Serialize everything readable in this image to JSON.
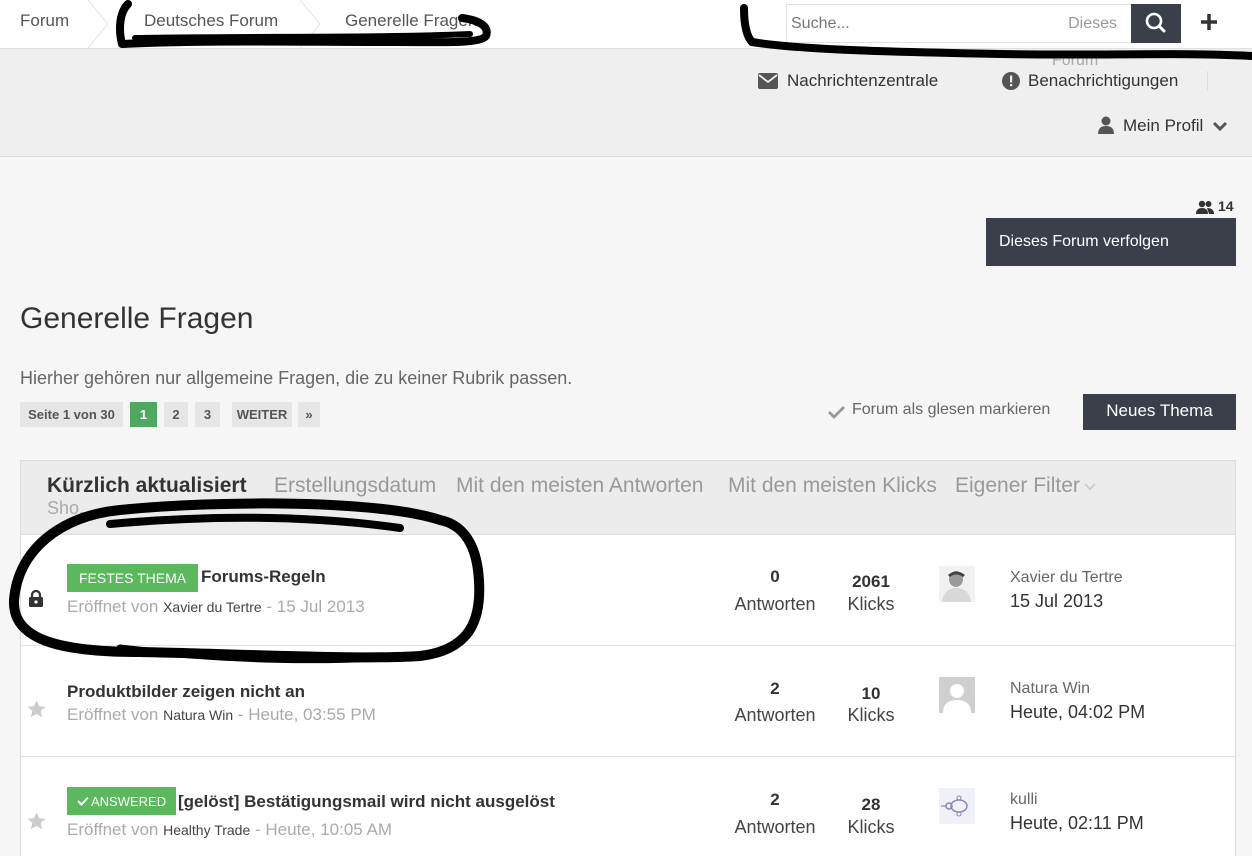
{
  "breadcrumb": {
    "items": [
      "Forum",
      "Deutsches Forum",
      "Generelle Fragen"
    ]
  },
  "search": {
    "placeholder": "Suche...",
    "scope": "Dieses",
    "scope_overflow": "Forum"
  },
  "header": {
    "messages": "Nachrichtenzentrale",
    "notifications": "Benachrichtigungen",
    "profile": "Mein Profil"
  },
  "forum": {
    "follower_count": "14",
    "follow_button": "Dieses Forum verfolgen",
    "title": "Generelle Fragen",
    "description": "Hierher gehören nur allgemeine Fragen, die zu keiner Rubrik passen.",
    "mark_read": "Forum als glesen markieren",
    "new_topic": "Neues Thema"
  },
  "pagination": {
    "label": "Seite 1 von 30",
    "pages": [
      "1",
      "2",
      "3"
    ],
    "next": "WEITER",
    "last": "»"
  },
  "filters": {
    "tabs": [
      "Kürzlich aktualisiert",
      "Erstellungsdatum",
      "Mit den meisten Antworten",
      "Mit den meisten Klicks",
      "Eigener Filter"
    ],
    "sub": "Sho..."
  },
  "topics": [
    {
      "badge": "FESTES THEMA",
      "title": "Forums-Regeln",
      "opened_by": "Eröffnet von",
      "author": "Xavier du Tertre",
      "date": "- 15 Jul 2013",
      "replies": "0",
      "replies_label": "Antworten",
      "views": "2061",
      "views_label": "Klicks",
      "last_user": "Xavier du Tertre",
      "last_date": "15 Jul 2013"
    },
    {
      "badge": "",
      "title": "Produktbilder zeigen nicht an",
      "opened_by": "Eröffnet von",
      "author": "Natura Win",
      "date": "- Heute, 03:55 PM",
      "replies": "2",
      "replies_label": "Antworten",
      "views": "10",
      "views_label": "Klicks",
      "last_user": "Natura Win",
      "last_date": "Heute, 04:02 PM"
    },
    {
      "badge": "ANSWERED",
      "title": "[gelöst] Bestätigungsmail wird nicht ausgelöst",
      "opened_by": "Eröffnet von",
      "author": "Healthy Trade",
      "date": "- Heute, 10:05 AM",
      "replies": "2",
      "replies_label": "Antworten",
      "views": "28",
      "views_label": "Klicks",
      "last_user": "kulli",
      "last_date": "Heute, 02:11 PM"
    }
  ],
  "colors": {
    "dark_button": "#3a3f4a",
    "badge_green": "#5cb85c",
    "page_active": "#4fa861"
  }
}
